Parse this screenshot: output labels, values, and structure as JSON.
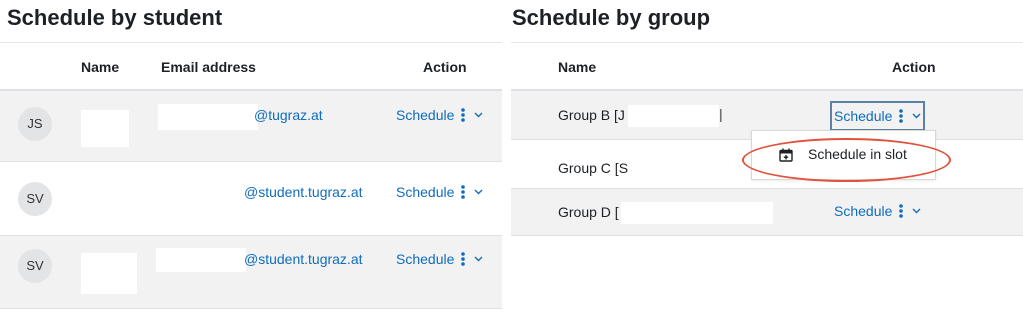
{
  "left": {
    "title": "Schedule by student",
    "columns": {
      "name": "Name",
      "email": "Email address",
      "action": "Action"
    },
    "rows": [
      {
        "initials": "JS",
        "email": "@tugraz.at",
        "action": "Schedule"
      },
      {
        "initials": "SV",
        "email": "@student.tugraz.at",
        "action": "Schedule"
      },
      {
        "initials": "SV",
        "email": "@student.tugraz.at",
        "action": "Schedule"
      }
    ]
  },
  "right": {
    "title": "Schedule by group",
    "columns": {
      "name": "Name",
      "action": "Action"
    },
    "rows": [
      {
        "name": "Group B [J",
        "action": "Schedule"
      },
      {
        "name": "Group C [S",
        "action": ""
      },
      {
        "name": "Group D [",
        "action": "Schedule"
      }
    ],
    "menu": {
      "item": "Schedule in slot",
      "icon": "calendar-plus-icon"
    }
  },
  "colors": {
    "link": "#0f6cbf",
    "highlight": "#e0533e",
    "stripe": "#f2f2f2"
  }
}
